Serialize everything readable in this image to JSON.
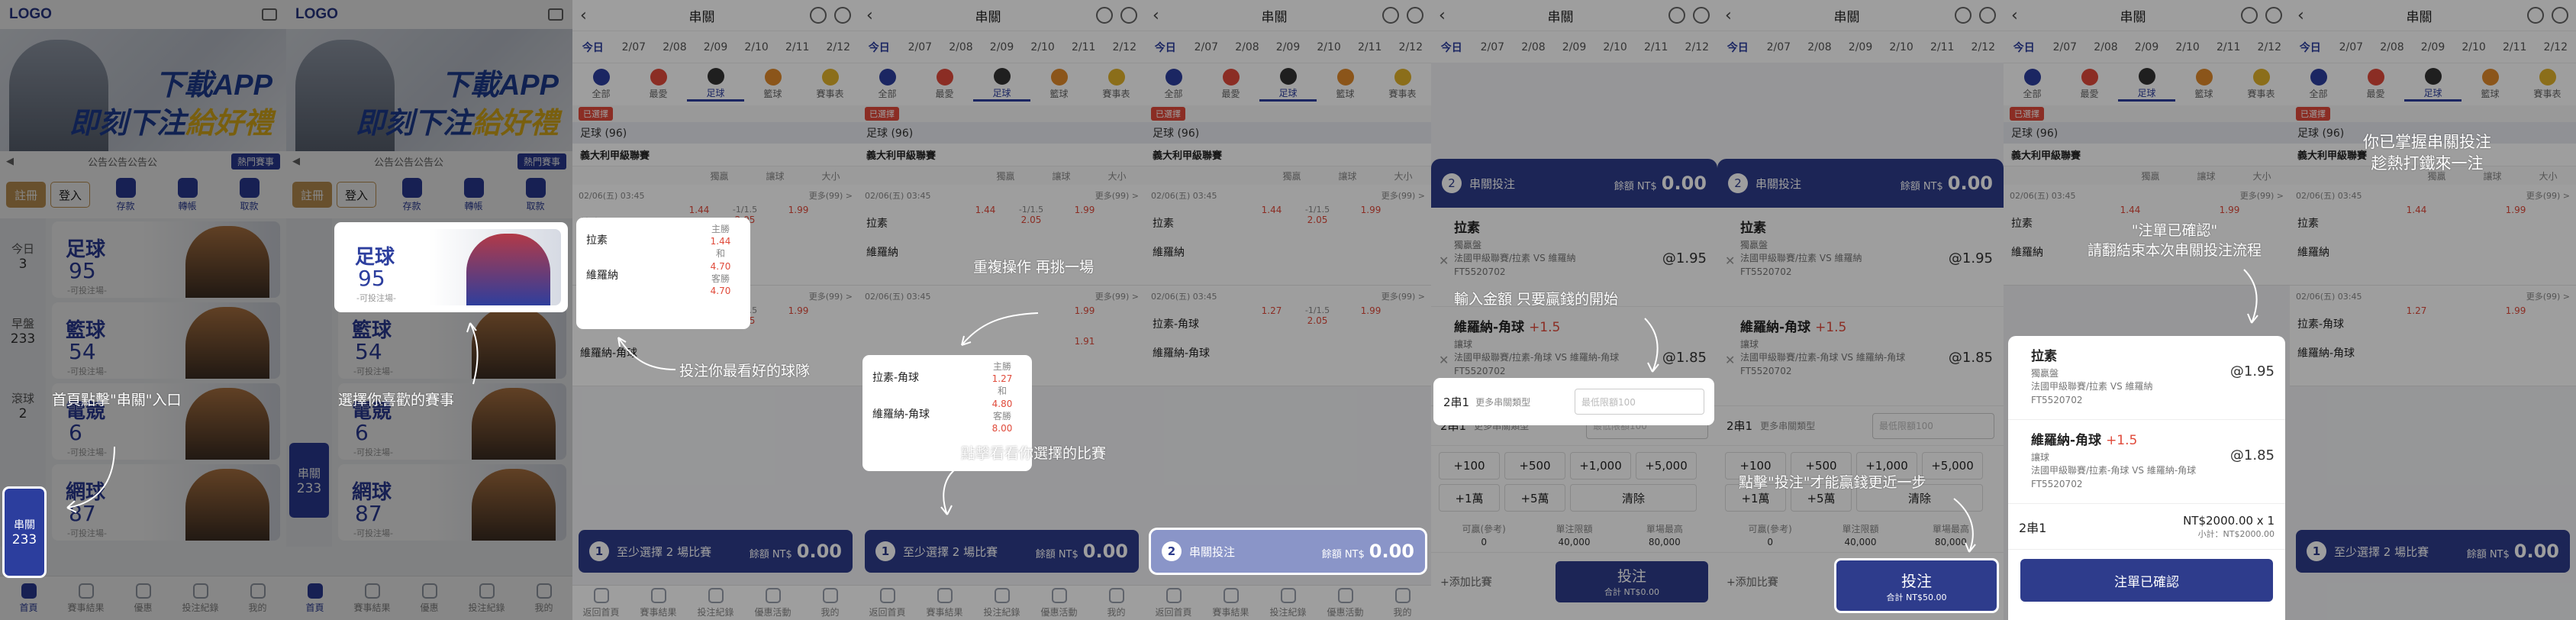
{
  "home": {
    "logo": "LOGO",
    "banner_line1": "下載APP",
    "banner_line2a": "即刻下注",
    "banner_line2b": "給好禮",
    "marquee": "公告公告公告公",
    "marquee_btn": "熱門賽事",
    "register": "註冊",
    "login": "登入",
    "quick": [
      "存款",
      "轉帳",
      "取款"
    ],
    "sidebar": [
      {
        "label": "今日",
        "count": "3"
      },
      {
        "label": "早盤",
        "count": "233"
      },
      {
        "label": "滾球",
        "count": "2"
      },
      {
        "label": "串關",
        "count": "233"
      }
    ],
    "cards": [
      {
        "name": "足球",
        "count": "95",
        "sub": "-可投注場-"
      },
      {
        "name": "籃球",
        "count": "54",
        "sub": "-可投注場-"
      },
      {
        "name": "電競",
        "count": "6",
        "sub": "-可投注場-"
      },
      {
        "name": "網球",
        "count": "87",
        "sub": "-可投注場-"
      }
    ],
    "tabs": [
      "首頁",
      "賽事結果",
      "優惠",
      "投注紀錄",
      "我的"
    ]
  },
  "bet": {
    "title": "串關",
    "dates": [
      "今日",
      "2/07",
      "2/08",
      "2/09",
      "2/10",
      "2/11",
      "2/12"
    ],
    "sports": [
      "全部",
      "最愛",
      "足球",
      "籃球",
      "賽事表"
    ],
    "filter": "已選擇",
    "section": "足球 (96)",
    "league": "義大利甲級聯賽",
    "columns": [
      "",
      "獨贏",
      "讓球",
      "大小"
    ],
    "matches": [
      {
        "time": "02/06(五) 03:45",
        "more": "更多(99) >",
        "home": "拉素",
        "away": "維羅納",
        "odds": [
          [
            "主勝",
            "1.44"
          ],
          [
            "和",
            "4.70"
          ],
          [
            "客勝",
            "4.70"
          ]
        ],
        "hcp": [
          "-1/1.5",
          "+1/1.5"
        ],
        "hv": [
          "2.05",
          "1.81"
        ],
        "ou": [
          "1.99",
          "1.91"
        ]
      },
      {
        "time": "02/06(五) 03:45",
        "more": "更多(99) >",
        "home": "拉素-角球",
        "away": "維羅納-角球",
        "odds": [
          [
            "主勝",
            "1.27"
          ],
          [
            "和",
            "4.80"
          ],
          [
            "客勝",
            "8.00"
          ]
        ],
        "hcp": [
          "-1/1.5",
          "+1/1.5"
        ],
        "hv": [
          "2.05",
          "1.81"
        ],
        "ou": [
          "1.99",
          "1.91"
        ]
      }
    ],
    "bar_label": "至少選擇 2 場比賽",
    "bar_label2": "串關投注",
    "bar_count": "1",
    "bar_count2": "2",
    "bar_amt_label": "餘額 NT$",
    "bar_amt": "0.00",
    "tabs": [
      "返回首頁",
      "賽事結果",
      "投注紀錄",
      "優惠活動",
      "我的"
    ]
  },
  "slip": {
    "head": "串關投注",
    "head_num": "2",
    "amt_label": "餘額 NT$",
    "amt": "0.00",
    "sel1": {
      "name": "拉素",
      "market": "獨贏盤",
      "league": "法國甲級聯賽/拉素 VS 維羅納",
      "id": "FT5520702",
      "odds": "@1.95"
    },
    "sel2": {
      "name": "維羅納-角球",
      "hcp": "+1.5",
      "market": "讓球",
      "league": "法國甲級聯賽/拉素-角球 VS 維羅納-角球",
      "id": "FT5520702",
      "odds": "@1.85"
    },
    "combo": "2串1",
    "combo_more": "更多串關類型",
    "placeholder": "最低限額100",
    "chips": [
      "+100",
      "+500",
      "+1,000",
      "+5,000",
      "+1萬",
      "+5萬",
      "清除"
    ],
    "limits": [
      [
        "可贏(參考)",
        "0"
      ],
      [
        "單注限額",
        "40,000"
      ],
      [
        "單場最高",
        "80,000"
      ]
    ],
    "add": "+添加比賽",
    "go": "投注",
    "go_sub": "合計 NT$0.00",
    "go_sub2": "合計 NT$50.00"
  },
  "conf": {
    "combo": "2串1",
    "total": "NT$2000.00 x 1",
    "subtotal": "小計：NT$2000.00",
    "btn": "注單已確認"
  },
  "notes": {
    "n1": "首頁點擊\"串關\"入口",
    "n2": "選擇你喜歡的賽事",
    "n3": "投注你最看好的球隊",
    "n4": "重複操作 再挑一場",
    "n5": "點擊看看你選擇的比賽",
    "n6": "輸入金額 只要贏錢的開始",
    "n7": "點擊\"投注\"才能贏錢更近一步",
    "n8a": "\"注單已確認\"",
    "n8b": "請翻結束本次串關投注流程",
    "n9a": "你已掌握串關投注",
    "n9b": "趁熱打鐵來一注"
  }
}
